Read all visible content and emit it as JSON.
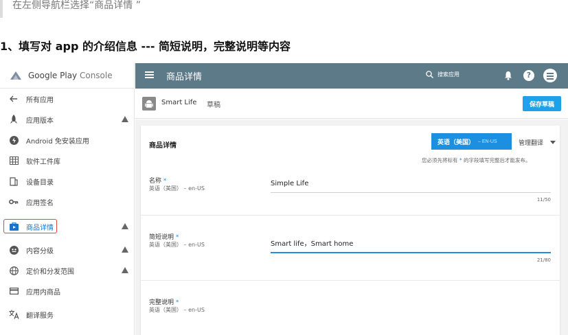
{
  "intro_text": "在左侧导航栏选择“商品详情 ”",
  "section_heading": "1、填写对 app 的介绍信息 --- 简短说明，完整说明等内容",
  "brand": {
    "name": "Google Play",
    "suffix": " Console"
  },
  "sidebar": {
    "items": [
      {
        "label": "所有应用",
        "icon": "arrow-back-icon",
        "warning": false,
        "active": false
      },
      {
        "label": "应用版本",
        "icon": "rocket-icon",
        "warning": true,
        "active": false
      },
      {
        "label": "Android 免安装应用",
        "icon": "instant-app-icon",
        "warning": false,
        "active": false
      },
      {
        "label": "软件工件库",
        "icon": "library-icon",
        "warning": false,
        "active": false
      },
      {
        "label": "设备目录",
        "icon": "device-catalog-icon",
        "warning": false,
        "active": false
      },
      {
        "label": "应用签名",
        "icon": "key-icon",
        "warning": false,
        "active": false
      },
      {
        "label": "商品详情",
        "icon": "store-listing-icon",
        "warning": true,
        "active": true
      },
      {
        "label": "内容分级",
        "icon": "content-rating-icon",
        "warning": true,
        "active": false
      },
      {
        "label": "定价和分发范围",
        "icon": "globe-icon",
        "warning": true,
        "active": false
      },
      {
        "label": "应用内商品",
        "icon": "card-icon",
        "warning": false,
        "active": false
      },
      {
        "label": "翻译服务",
        "icon": "translate-icon",
        "warning": false,
        "active": false
      }
    ]
  },
  "topbar": {
    "title": "商品详情",
    "search_label": "搜索应用"
  },
  "app": {
    "name": "Smart Life",
    "status": "草稿",
    "save_label": "保存草稿"
  },
  "card": {
    "title": "商品详情",
    "language_main": "英语（美国）",
    "language_code": "– EN-US",
    "manage_translations": "管理翻译",
    "notice_prefix": "您必须先将标有",
    "notice_star": "*",
    "notice_suffix": "的字段填写完整后才能发布。",
    "fields": [
      {
        "label": "名称",
        "required": "*",
        "sub": "英语（美国） – en-US",
        "value": "Simple Life",
        "count": "11/50"
      },
      {
        "label": "简短说明",
        "required": "*",
        "sub": "英语（美国） – en-US",
        "value": "Smart life，Smart home",
        "count": "21/80"
      },
      {
        "label": "完整说明",
        "required": "*",
        "sub": "英语（美国） – en-US",
        "value": "",
        "count": ""
      }
    ]
  },
  "colors": {
    "topbar": "#5d7a89",
    "accent": "#1d8fe1",
    "active_outline": "#e2473c"
  }
}
